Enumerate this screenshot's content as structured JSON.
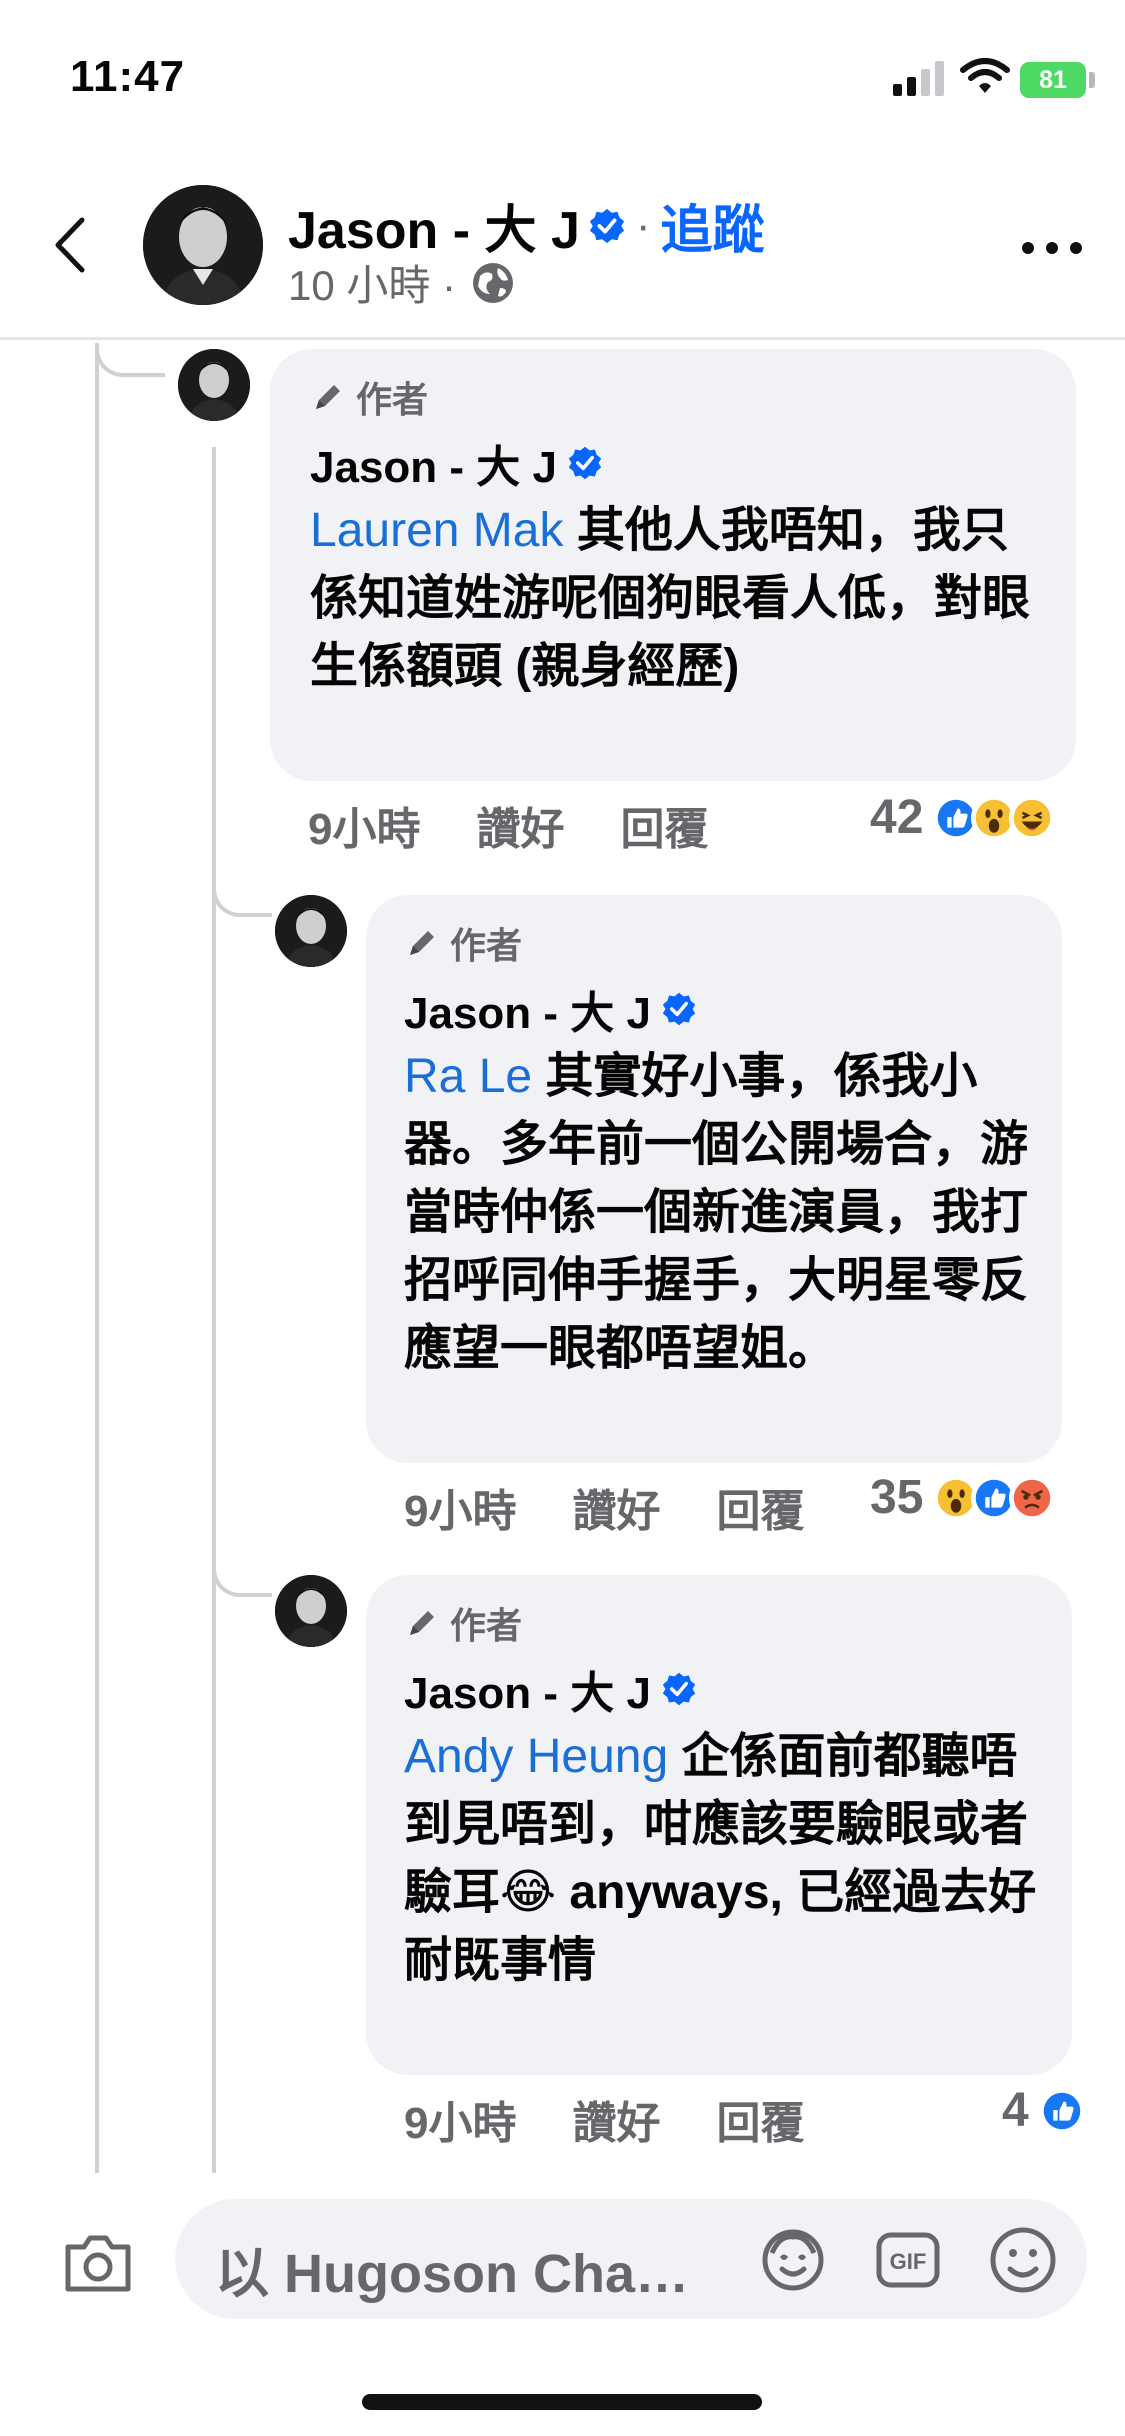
{
  "status_bar": {
    "time": "11:47",
    "battery": "81"
  },
  "header": {
    "name": "Jason - 大 J",
    "dot": "·",
    "follow": "追蹤",
    "time": "10 小時 ·"
  },
  "comments": [
    {
      "author_tag": "作者",
      "name": "Jason - 大 J",
      "mention": "Lauren Mak",
      "text": " 其他人我唔知，我只係知道姓游呢個狗眼看人低，對眼生係額頭 (親身經歷)",
      "time": "9小時",
      "like": "讚好",
      "reply": "回覆",
      "reaction_count": "42",
      "reactions": [
        "like",
        "wow",
        "haha"
      ]
    },
    {
      "author_tag": "作者",
      "name": "Jason - 大 J",
      "mention": "Ra Le",
      "text": " 其實好小事，係我小器。多年前一個公開場合，游當時仲係一個新進演員，我打招呼同伸手握手，大明星零反應望一眼都唔望姐。",
      "time": "9小時",
      "like": "讚好",
      "reply": "回覆",
      "reaction_count": "35",
      "reactions": [
        "wow",
        "like",
        "angry"
      ]
    },
    {
      "author_tag": "作者",
      "name": "Jason - 大 J",
      "mention": "Andy Heung",
      "text": " 企係面前都聽唔到見唔到，咁應該要驗眼或者驗耳😂 anyways, 已經過去好耐既事情",
      "time": "9小時",
      "like": "讚好",
      "reply": "回覆",
      "reaction_count": "4",
      "reactions": [
        "like"
      ]
    }
  ],
  "composer": {
    "placeholder": "以 Hugoson Cha…",
    "gif_label": "GIF"
  },
  "colors": {
    "link": "#1a6ed8",
    "follow": "#0866ff",
    "bubble": "#f0f2f5",
    "meta": "#65676b"
  }
}
